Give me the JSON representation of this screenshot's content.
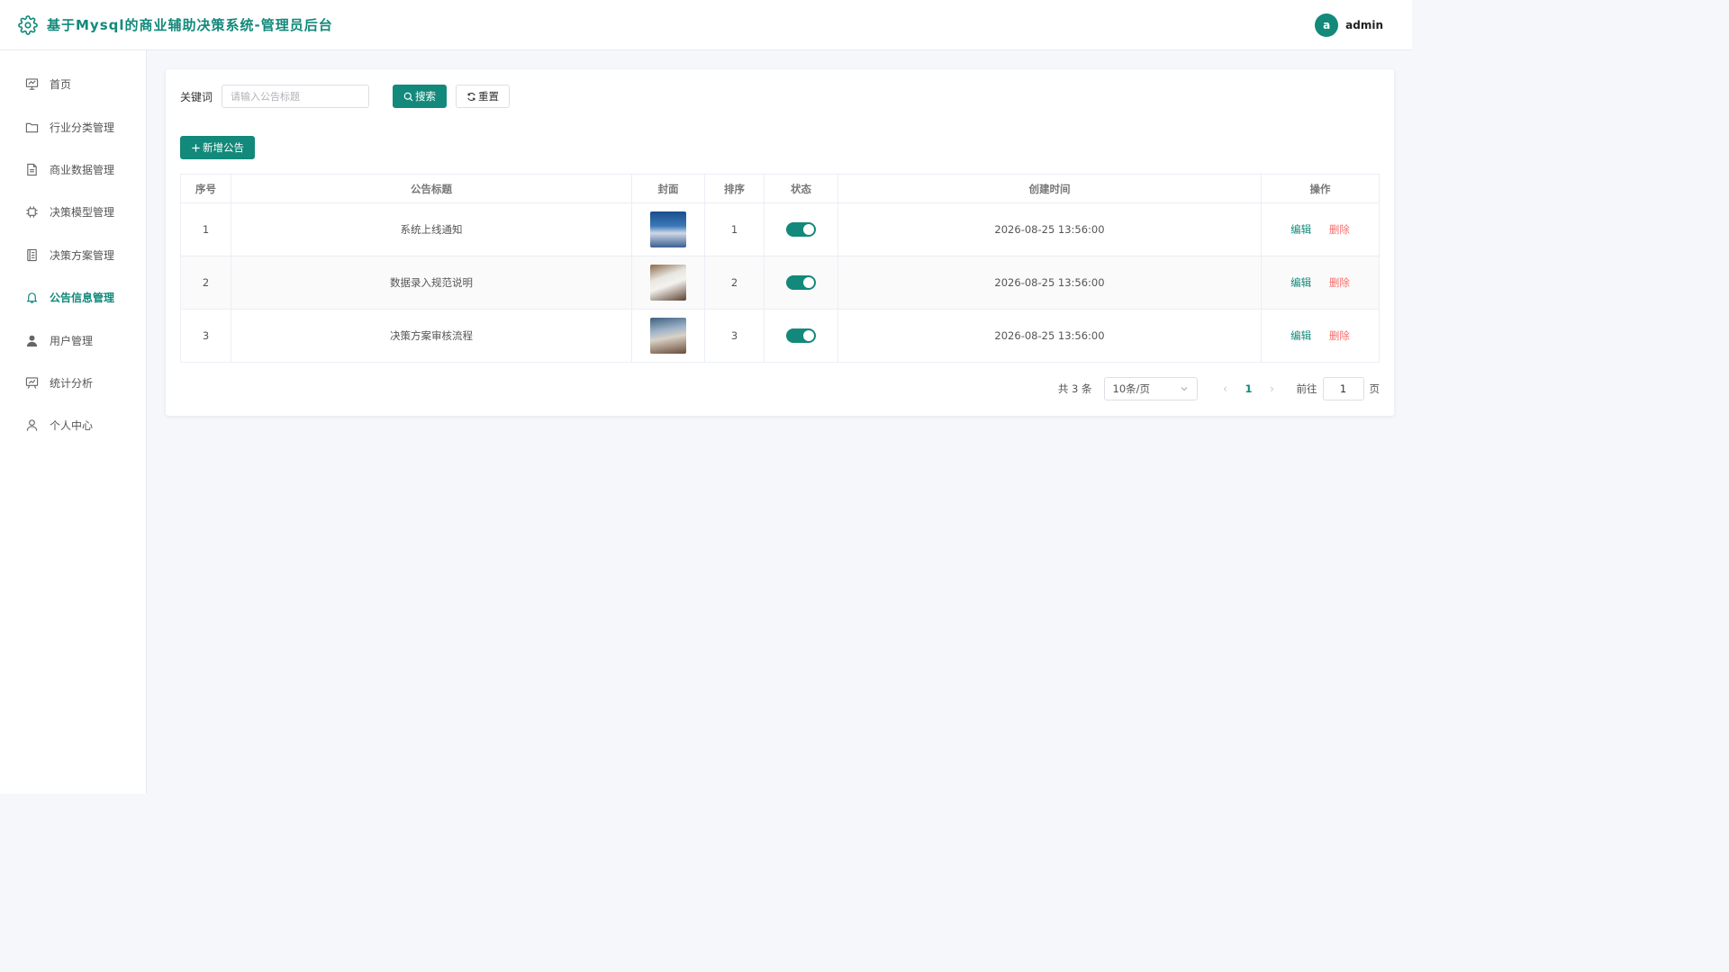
{
  "header": {
    "title": "基于Mysql的商业辅助决策系统-管理员后台",
    "user_initial": "a",
    "username": "admin"
  },
  "sidebar": {
    "items": [
      {
        "label": "首页",
        "icon": "dashboard-icon"
      },
      {
        "label": "行业分类管理",
        "icon": "folder-icon"
      },
      {
        "label": "商业数据管理",
        "icon": "document-icon"
      },
      {
        "label": "决策模型管理",
        "icon": "chip-icon"
      },
      {
        "label": "决策方案管理",
        "icon": "notebook-icon"
      },
      {
        "label": "公告信息管理",
        "icon": "bell-icon",
        "active": true
      },
      {
        "label": "用户管理",
        "icon": "user-solid-icon"
      },
      {
        "label": "统计分析",
        "icon": "presentation-icon"
      },
      {
        "label": "个人中心",
        "icon": "user-icon"
      }
    ]
  },
  "search": {
    "label": "关键词",
    "placeholder": "请输入公告标题",
    "search_btn": "搜索",
    "reset_btn": "重置"
  },
  "toolbar": {
    "add_btn": "新增公告"
  },
  "table": {
    "headers": [
      "序号",
      "公告标题",
      "封面",
      "排序",
      "状态",
      "创建时间",
      "操作"
    ],
    "rows": [
      {
        "index": "1",
        "title": "系统上线通知",
        "sort": "1",
        "status_on": true,
        "created": "2026-08-25 13:56:00",
        "edit": "编辑",
        "delete": "删除"
      },
      {
        "index": "2",
        "title": "数据录入规范说明",
        "sort": "2",
        "status_on": true,
        "created": "2026-08-25 13:56:00",
        "edit": "编辑",
        "delete": "删除"
      },
      {
        "index": "3",
        "title": "决策方案审核流程",
        "sort": "3",
        "status_on": true,
        "created": "2026-08-25 13:56:00",
        "edit": "编辑",
        "delete": "删除"
      }
    ]
  },
  "pagination": {
    "total": "共 3 条",
    "page_size": "10条/页",
    "current": "1",
    "goto_label": "前往",
    "goto_value": "1",
    "page_suffix": "页"
  },
  "colors": {
    "primary": "#12897a",
    "danger": "#f56c6c"
  }
}
